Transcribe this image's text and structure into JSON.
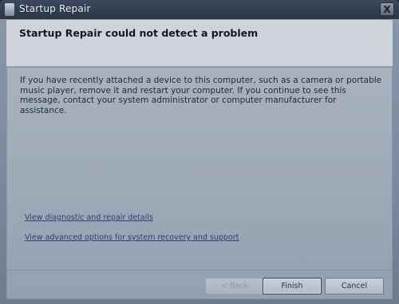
{
  "window": {
    "title": "Startup Repair",
    "close_label": "X"
  },
  "header": {
    "heading": "Startup Repair could not detect a problem"
  },
  "main": {
    "message": "If you have recently attached a device to this computer, such as a camera or portable music player, remove it and restart your computer. If you continue to see this message, contact your system administrator or computer manufacturer for assistance.",
    "link_diagnostics": "View diagnostic and repair details",
    "link_advanced": "View advanced options for system recovery and support"
  },
  "footer": {
    "back_label": "< Back",
    "finish_label": "Finish",
    "cancel_label": "Cancel"
  }
}
